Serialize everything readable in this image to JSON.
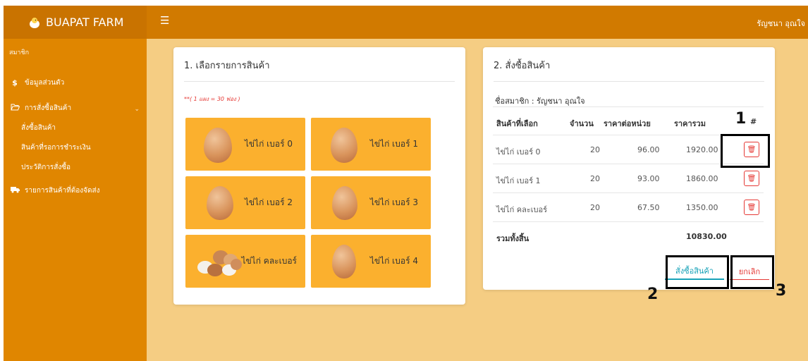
{
  "header": {
    "brand": "BUAPAT FARM",
    "menu_icon": "hamburger-icon",
    "user": "รัญชนา อุณใจ"
  },
  "sidebar": {
    "section": "สมาชิก",
    "items": [
      {
        "label": "ข้อมูลส่วนตัว",
        "icon": "dollar-icon"
      },
      {
        "label": "การสั่งซื้อสินค้า",
        "icon": "folder-open-icon"
      },
      {
        "label": "รายการสินค้าที่ต้องจัดส่ง",
        "icon": "truck-icon"
      }
    ],
    "sub_items": [
      "สั่งซื้อสินค้า",
      "สินค้าที่รอการชำระเงิน",
      "ประวัติการสั่งซื้อ"
    ]
  },
  "product_panel": {
    "title": "1. เลือกรายการสินค้า",
    "note": "**( 1 แผง = 30 ฟอง )",
    "products": [
      "ไข่ไก่ เบอร์ 0",
      "ไข่ไก่ เบอร์ 1",
      "ไข่ไก่ เบอร์ 2",
      "ไข่ไก่ เบอร์ 3",
      "ไข่ไก่ คละเบอร์",
      "ไข่ไก่ เบอร์ 4"
    ]
  },
  "order_panel": {
    "title": "2. สั่งซื้อสินค้า",
    "member": "ชื่อสมาชิก : รัญชนา อุณใจ",
    "columns": [
      "สินค้าที่เลือก",
      "จำนวน",
      "ราคาต่อหน่วย",
      "ราคารวม",
      "#"
    ],
    "rows": [
      {
        "item": "ไข่ไก่ เบอร์ 0",
        "qty": "20",
        "unit": "96.00",
        "total": "1920.00"
      },
      {
        "item": "ไข่ไก่ เบอร์ 1",
        "qty": "20",
        "unit": "93.00",
        "total": "1860.00"
      },
      {
        "item": "ไข่ไก่ คละเบอร์",
        "qty": "20",
        "unit": "67.50",
        "total": "1350.00"
      }
    ],
    "grand_total_label": "รวมทั้งสิ้น",
    "grand_total": "10830.00",
    "order_button": "สั่งซื้อสินค้า",
    "cancel_button": "ยกเลิก"
  },
  "annotations": [
    "1",
    "2",
    "3"
  ],
  "colors": {
    "topbar": "#d17a00",
    "sidebar": "#e08600",
    "background": "#f5cd83",
    "tile": "#fbb02e",
    "danger": "#e53935",
    "info": "#17a2b8"
  }
}
